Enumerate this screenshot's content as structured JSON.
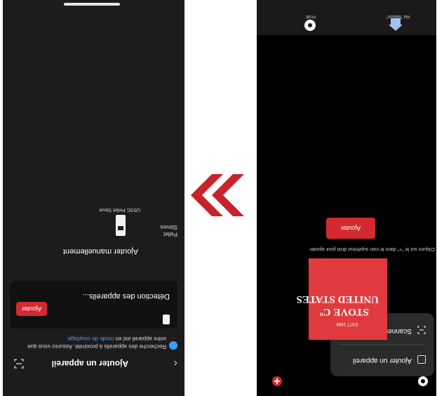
{
  "left_screen": {
    "header": {
      "title": "Ajouter un appareil"
    },
    "scan_hint": {
      "text1": "Recherche des appareils à proximité. Assurez-vous que",
      "text2_prefix": "votre appareil est en",
      "text2_link": "mode de couplage."
    },
    "detect_card": {
      "title": "Détection des appareils...",
      "button_label": "Ajouter"
    },
    "manual": {
      "title": "Ajouter manuellement"
    },
    "category": {
      "label_line1": "Pellet",
      "label_line2": "Stoves",
      "device_name": "USSC Pellet Stove"
    }
  },
  "right_screen": {
    "menu": {
      "item1": "Ajouter un appareil",
      "item2": "Scanner le QR code"
    },
    "poster": {
      "line1": "UNITED STATES",
      "line2": "STOVE Cº",
      "line3": "ESTT 1869"
    },
    "hint": "Cliquez sur le \"+\" dans le coin supérieur droit pour ajouter",
    "button_label": "Ajouter",
    "bottom_nav": {
      "home_label": "Ma \"Maison\"",
      "profile_label": "Profil"
    }
  },
  "colors": {
    "accent": "#d42a2f",
    "dark": "#1c1c1c"
  }
}
